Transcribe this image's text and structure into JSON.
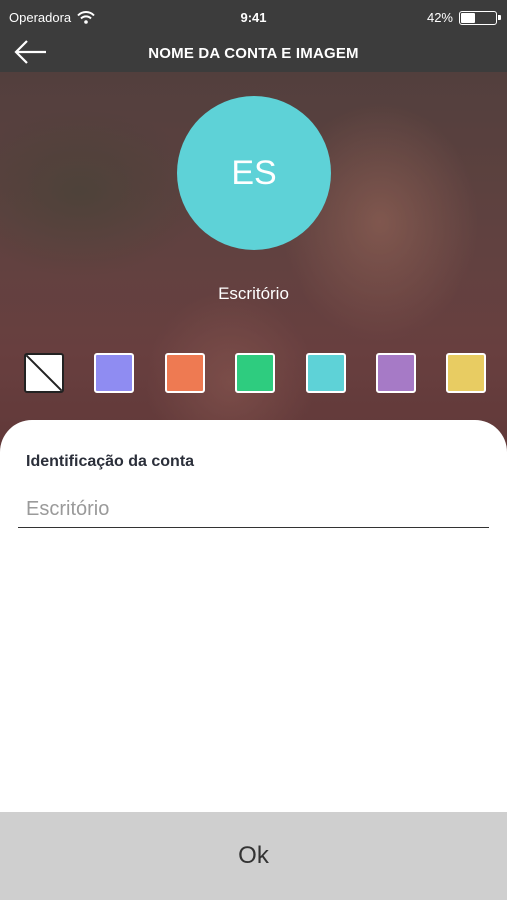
{
  "status_bar": {
    "carrier": "Operadora",
    "time": "9:41",
    "battery_percent": "42%",
    "battery_level": 0.42
  },
  "header": {
    "title": "NOME DA CONTA E IMAGEM",
    "back_icon": "arrow-left-icon"
  },
  "profile": {
    "initials": "ES",
    "name": "Escritório",
    "avatar_color": "#5ed2d7"
  },
  "color_options": [
    {
      "name": "none",
      "color": "#ffffff"
    },
    {
      "name": "periwinkle",
      "color": "#8f8cf2"
    },
    {
      "name": "orange",
      "color": "#ee7a52"
    },
    {
      "name": "green",
      "color": "#2ecc7f"
    },
    {
      "name": "cyan",
      "color": "#5ed2d7"
    },
    {
      "name": "purple",
      "color": "#a67ac6"
    },
    {
      "name": "yellow",
      "color": "#e8cc62"
    }
  ],
  "form": {
    "label": "Identificação da conta",
    "placeholder": "Escritório",
    "value": ""
  },
  "actions": {
    "ok_label": "Ok"
  }
}
